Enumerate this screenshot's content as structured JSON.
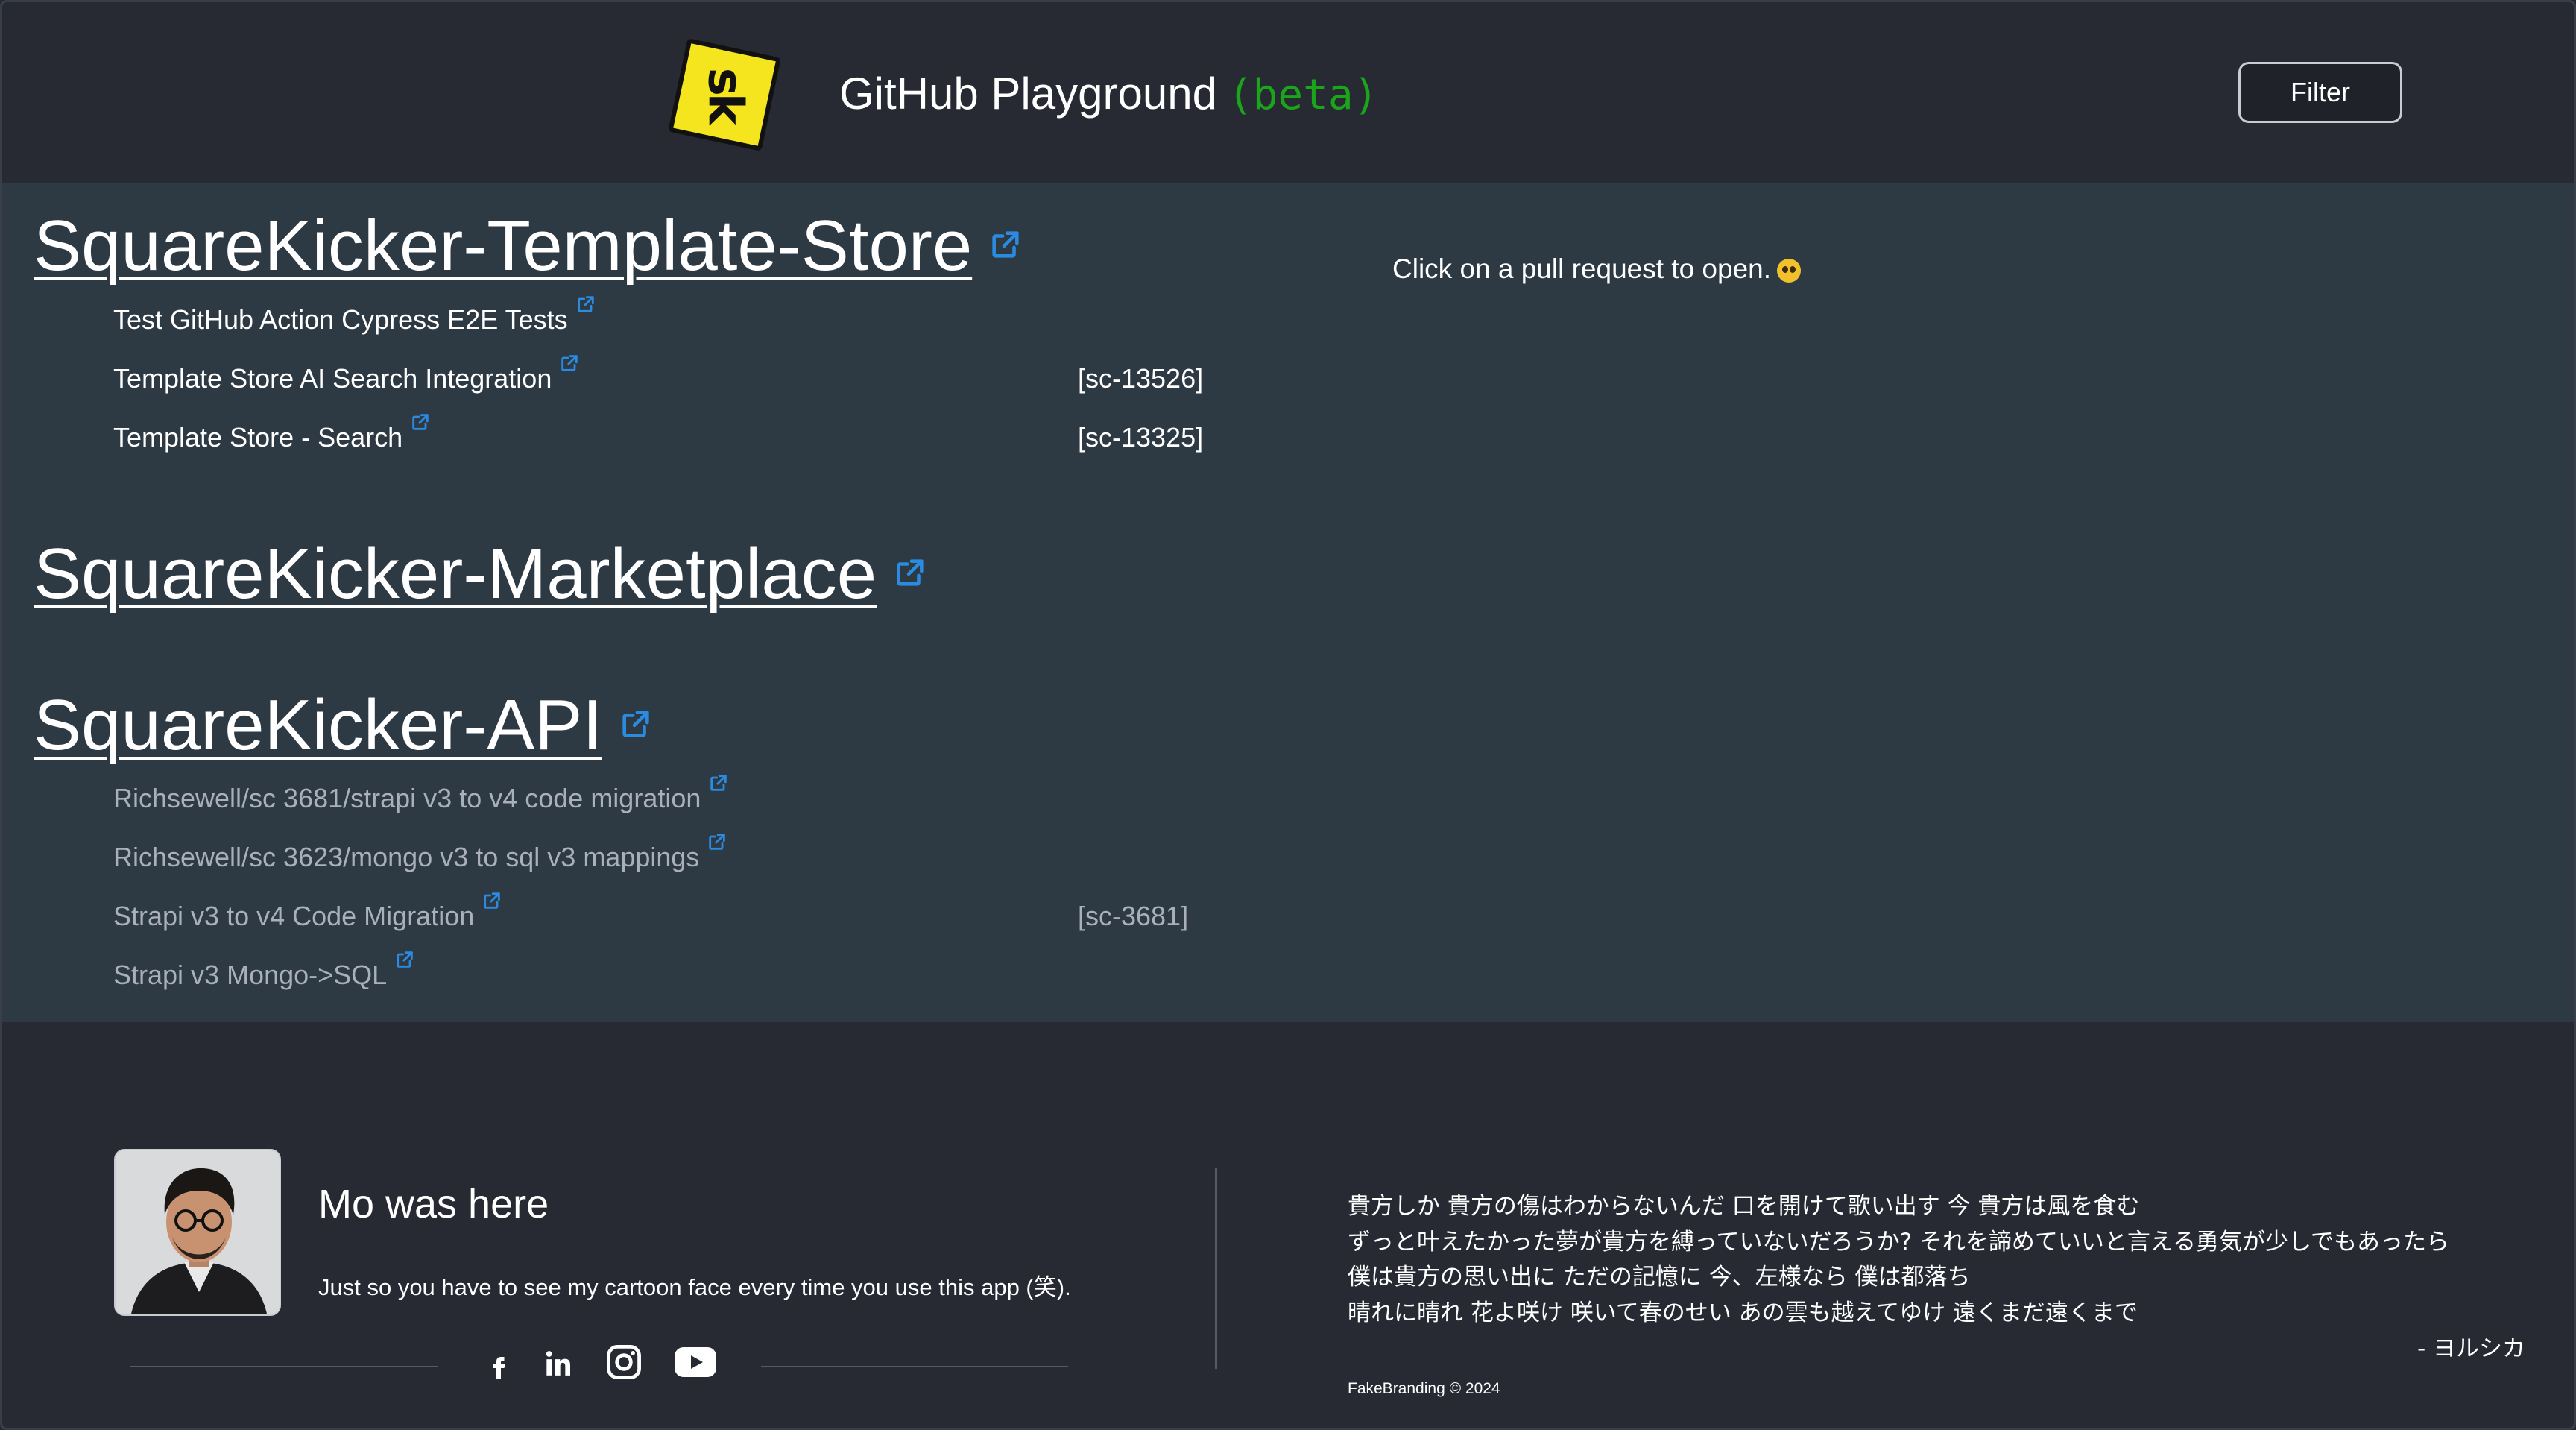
{
  "header": {
    "logo_text": "sk",
    "title": "GitHub Playground",
    "badge": "(beta)",
    "filter_label": "Filter"
  },
  "main": {
    "hint": "Click on a pull request to open.",
    "repos": [
      {
        "name": "SquareKicker-Template-Store",
        "pull_requests": [
          {
            "title": "Test GitHub Action Cypress E2E Tests",
            "tag": "",
            "state": "open"
          },
          {
            "title": "Template Store AI Search Integration",
            "tag": "[sc-13526]",
            "state": "open"
          },
          {
            "title": "Template Store - Search",
            "tag": "[sc-13325]",
            "state": "open"
          }
        ]
      },
      {
        "name": "SquareKicker-Marketplace",
        "pull_requests": []
      },
      {
        "name": "SquareKicker-API",
        "pull_requests": [
          {
            "title": "Richsewell/sc 3681/strapi v3 to v4 code migration",
            "tag": "",
            "state": "muted"
          },
          {
            "title": "Richsewell/sc 3623/mongo v3 to sql v3 mappings",
            "tag": "",
            "state": "muted"
          },
          {
            "title": "Strapi v3 to v4 Code Migration",
            "tag": "[sc-3681]",
            "state": "muted"
          },
          {
            "title": "Strapi v3 Mongo->SQL",
            "tag": "",
            "state": "muted"
          }
        ]
      }
    ]
  },
  "footer": {
    "author_name": "Mo was here",
    "author_bio": "Just so you have to see my cartoon face every time you use this app (笑).",
    "social": [
      "facebook-icon",
      "linkedin-icon",
      "instagram-icon",
      "youtube-icon"
    ],
    "lyrics": [
      "貴方しか 貴方の傷はわからないんだ 口を開けて歌い出す 今 貴方は風を食む",
      "ずっと叶えたかった夢が貴方を縛っていないだろうか? それを諦めていいと言える勇気が少しでもあったら",
      "僕は貴方の思い出に ただの記憶に 今、左様なら 僕は都落ち",
      "晴れに晴れ 花よ咲け 咲いて春のせい あの雲も越えてゆけ 遠くまだ遠くまで"
    ],
    "lyrics_author": "- ヨルシカ",
    "copyright": "FakeBranding © 2024"
  },
  "colors": {
    "header_bg": "#272a33",
    "main_bg": "#2d3943",
    "beta": "#1aa51a",
    "link_icon": "#2b8be0",
    "logo": "#f4e51e"
  }
}
